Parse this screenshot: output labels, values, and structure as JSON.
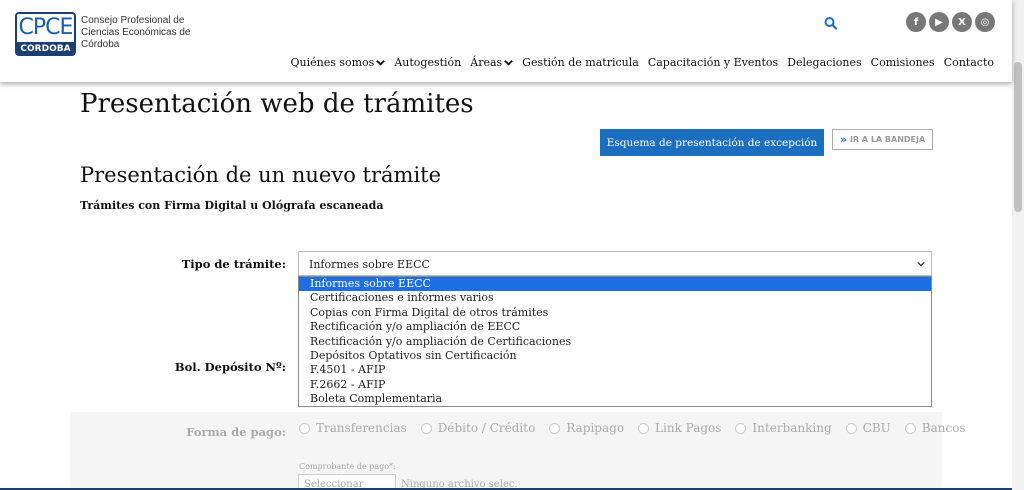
{
  "header": {
    "logo_top": "CPCE",
    "logo_bottom": "CORDOBA",
    "org_name": "Consejo Profesional de Ciencias Económicas de Córdoba",
    "socials": [
      {
        "icon": "facebook-icon",
        "glyph": "f"
      },
      {
        "icon": "youtube-icon",
        "glyph": "▶"
      },
      {
        "icon": "x-icon",
        "glyph": "X"
      },
      {
        "icon": "instagram-icon",
        "glyph": "◎"
      }
    ],
    "nav": [
      {
        "label": "Quiénes somos",
        "has_chevron": true
      },
      {
        "label": "Autogestión",
        "has_chevron": false
      },
      {
        "label": "Áreas",
        "has_chevron": true
      },
      {
        "label": "Gestión de matricula",
        "has_chevron": false
      },
      {
        "label": "Capacitación y Eventos",
        "has_chevron": false
      },
      {
        "label": "Delegaciones",
        "has_chevron": false
      },
      {
        "label": "Comisiones",
        "has_chevron": false
      },
      {
        "label": "Contacto",
        "has_chevron": false
      }
    ]
  },
  "main": {
    "page_title": "Presentación web de trámites",
    "esquema_button": "Esquema de presentación de excepción",
    "bandeja_button": "IR A LA BANDEJA",
    "section_title": "Presentación de un nuevo trámite",
    "subtitle": "Trámites con Firma Digital u Ológrafa escaneada",
    "tipo_label": "Tipo de trámite:",
    "tipo_selected": "Informes sobre EECC",
    "tipo_options": [
      "Informes sobre EECC",
      "Certificaciones e informes varios",
      "Copias con Firma Digital de otros trámites",
      "Rectificación y/o ampliación de EECC",
      "Rectificación y/o ampliación de Certificaciones",
      "Depósitos Optativos sin Certificación",
      "F.4501 - AFIP",
      "F.2662 - AFIP",
      "Boleta Complementaria"
    ],
    "bol_label": "Bol. Depósito Nº:",
    "forma_pago_label": "Forma de pago:",
    "payment_options": [
      "Transferencias",
      "Débito / Crédito",
      "Rapipago",
      "Link Pagos",
      "Interbanking",
      "CBU",
      "Bancos"
    ],
    "comprobante_label": "Comprobante de pago*:",
    "file_button": "Seleccionar archivo",
    "file_none": "Ninguno archivo selec."
  },
  "colors": {
    "brand_navy": "#1b3f6e",
    "accent_blue": "#1c6fbf",
    "selected_option": "#1c6fe0"
  }
}
